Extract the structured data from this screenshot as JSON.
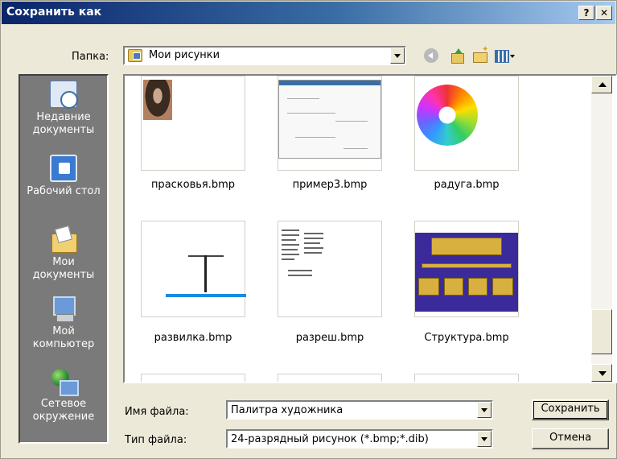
{
  "window": {
    "title": "Сохранить как",
    "help_label": "?",
    "close_label": "✕"
  },
  "folder": {
    "label": "Папка:",
    "current": "Мои рисунки"
  },
  "places": [
    {
      "label": "Недавние документы",
      "icon": "recent-documents-icon"
    },
    {
      "label": "Рабочий стол",
      "icon": "desktop-icon"
    },
    {
      "label": "Мои документы",
      "icon": "my-documents-icon"
    },
    {
      "label": "Мой компьютер",
      "icon": "my-computer-icon"
    },
    {
      "label": "Сетевое окружение",
      "icon": "network-icon"
    }
  ],
  "files": [
    {
      "name": "прасковья.bmp"
    },
    {
      "name": "пример3.bmp"
    },
    {
      "name": "радуга.bmp"
    },
    {
      "name": "развилка.bmp"
    },
    {
      "name": "разреш.bmp"
    },
    {
      "name": "Структура.bmp"
    }
  ],
  "filename": {
    "label": "Имя файла:",
    "value": "Палитра художника"
  },
  "filetype": {
    "label": "Тип файла:",
    "value": "24-разрядный рисунок (*.bmp;*.dib)"
  },
  "buttons": {
    "save": "Сохранить",
    "cancel": "Отмена"
  }
}
